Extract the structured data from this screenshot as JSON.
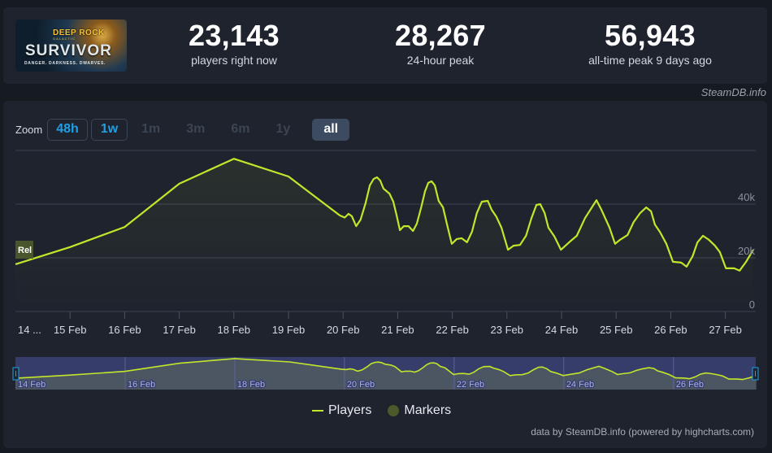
{
  "header": {
    "game_title_line1": "DEEP ROCK",
    "game_title_line2": "GALACTIC",
    "game_title_main": "SURVIVOR",
    "game_tagline": "DANGER. DARKNESS. DWARVES.",
    "stats": [
      {
        "value": "23,143",
        "label": "players right now"
      },
      {
        "value": "28,267",
        "label": "24-hour peak"
      },
      {
        "value": "56,943",
        "label": "all-time peak 9 days ago"
      }
    ],
    "credit": "SteamDB.info"
  },
  "zoom": {
    "label": "Zoom",
    "buttons": [
      {
        "label": "48h",
        "state": "active"
      },
      {
        "label": "1w",
        "state": "active"
      },
      {
        "label": "1m",
        "state": "disabled"
      },
      {
        "label": "3m",
        "state": "disabled"
      },
      {
        "label": "6m",
        "state": "disabled"
      },
      {
        "label": "1y",
        "state": "disabled"
      },
      {
        "label": "all",
        "state": "selected"
      }
    ]
  },
  "colors": {
    "line": "#c2e62a",
    "marker": "#4b5a2b",
    "navigator_mask": "#363d6b",
    "accent": "#1fa0e6"
  },
  "legend": {
    "players": "Players",
    "markers": "Markers"
  },
  "footer": "data by SteamDB.info (powered by highcharts.com)",
  "chart_data": {
    "type": "line",
    "title": "",
    "xlabel": "",
    "ylabel": "",
    "x_unit": "days since 14 Feb 00:00",
    "xlim": [
      0,
      13.5
    ],
    "ylim": [
      0,
      60000
    ],
    "y_ticks": [
      0,
      20000,
      40000
    ],
    "y_tick_labels": [
      "0",
      "20k",
      "40k"
    ],
    "x_ticks": [
      0,
      1,
      2,
      3,
      4,
      5,
      6,
      7,
      8,
      9,
      10,
      11,
      12,
      13
    ],
    "x_tick_labels": [
      "14 ...",
      "15 Feb",
      "16 Feb",
      "17 Feb",
      "18 Feb",
      "19 Feb",
      "20 Feb",
      "21 Feb",
      "22 Feb",
      "23 Feb",
      "24 Feb",
      "25 Feb",
      "26 Feb",
      "27 Feb"
    ],
    "navigator_labels": [
      {
        "x": 0,
        "label": "14 Feb"
      },
      {
        "x": 2,
        "label": "16 Feb"
      },
      {
        "x": 4,
        "label": "18 Feb"
      },
      {
        "x": 6,
        "label": "20 Feb"
      },
      {
        "x": 8,
        "label": "22 Feb"
      },
      {
        "x": 10,
        "label": "24 Feb"
      },
      {
        "x": 12,
        "label": "26 Feb"
      }
    ],
    "grid": true,
    "legend_position": "bottom-center",
    "annotations": [
      {
        "x": 0,
        "label": "Rel"
      }
    ],
    "series": [
      {
        "name": "Players",
        "points": [
          [
            0.0,
            17600
          ],
          [
            1.0,
            24000
          ],
          [
            2.0,
            31500
          ],
          [
            3.0,
            47600
          ],
          [
            4.0,
            56900
          ],
          [
            5.0,
            50300
          ],
          [
            5.94,
            35800
          ],
          [
            6.03,
            35000
          ],
          [
            6.1,
            36400
          ],
          [
            6.16,
            35500
          ],
          [
            6.24,
            31800
          ],
          [
            6.32,
            34200
          ],
          [
            6.41,
            40300
          ],
          [
            6.49,
            47000
          ],
          [
            6.56,
            49400
          ],
          [
            6.62,
            50000
          ],
          [
            6.68,
            48800
          ],
          [
            6.74,
            45800
          ],
          [
            6.85,
            43900
          ],
          [
            6.92,
            40900
          ],
          [
            6.98,
            35800
          ],
          [
            7.04,
            30300
          ],
          [
            7.11,
            31800
          ],
          [
            7.2,
            31800
          ],
          [
            7.28,
            30000
          ],
          [
            7.35,
            32700
          ],
          [
            7.43,
            38800
          ],
          [
            7.5,
            44800
          ],
          [
            7.56,
            47900
          ],
          [
            7.62,
            48500
          ],
          [
            7.68,
            47000
          ],
          [
            7.75,
            41200
          ],
          [
            7.83,
            38800
          ],
          [
            7.9,
            32700
          ],
          [
            7.99,
            25200
          ],
          [
            8.08,
            27000
          ],
          [
            8.17,
            27300
          ],
          [
            8.27,
            25800
          ],
          [
            8.36,
            29700
          ],
          [
            8.45,
            36700
          ],
          [
            8.54,
            40900
          ],
          [
            8.65,
            41200
          ],
          [
            8.72,
            37900
          ],
          [
            8.81,
            35200
          ],
          [
            8.9,
            31200
          ],
          [
            9.02,
            23000
          ],
          [
            9.12,
            24500
          ],
          [
            9.24,
            24800
          ],
          [
            9.35,
            28200
          ],
          [
            9.45,
            34800
          ],
          [
            9.54,
            39700
          ],
          [
            9.61,
            40000
          ],
          [
            9.69,
            36700
          ],
          [
            9.76,
            31200
          ],
          [
            9.87,
            27900
          ],
          [
            9.99,
            23000
          ],
          [
            10.14,
            25800
          ],
          [
            10.28,
            28200
          ],
          [
            10.43,
            34800
          ],
          [
            10.64,
            41500
          ],
          [
            10.73,
            37900
          ],
          [
            10.88,
            31200
          ],
          [
            10.98,
            25200
          ],
          [
            11.07,
            26700
          ],
          [
            11.21,
            28500
          ],
          [
            11.32,
            33300
          ],
          [
            11.44,
            36700
          ],
          [
            11.55,
            38800
          ],
          [
            11.64,
            37300
          ],
          [
            11.71,
            32400
          ],
          [
            11.8,
            29700
          ],
          [
            11.92,
            25200
          ],
          [
            12.04,
            18500
          ],
          [
            12.19,
            18200
          ],
          [
            12.29,
            16700
          ],
          [
            12.4,
            20600
          ],
          [
            12.49,
            25800
          ],
          [
            12.59,
            28200
          ],
          [
            12.7,
            26700
          ],
          [
            12.81,
            24500
          ],
          [
            12.9,
            22100
          ],
          [
            13.01,
            16100
          ],
          [
            13.16,
            16100
          ],
          [
            13.26,
            15200
          ],
          [
            13.38,
            18500
          ],
          [
            13.51,
            23000
          ]
        ]
      }
    ]
  }
}
